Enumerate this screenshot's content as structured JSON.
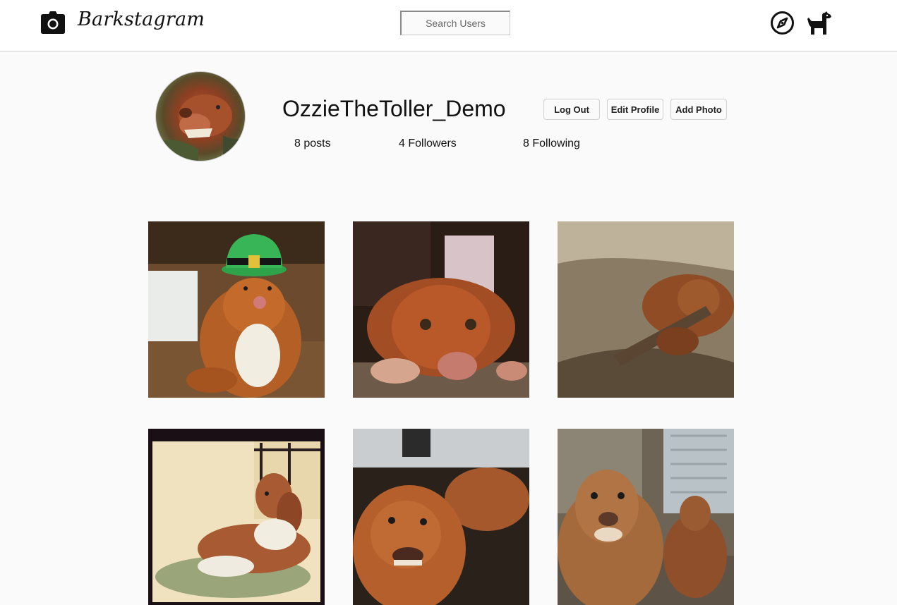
{
  "header": {
    "brand_title": "Barkstagram",
    "search": {
      "placeholder": "Search Users",
      "value": ""
    },
    "icons": [
      "camera-icon",
      "compass-icon",
      "dog-icon"
    ]
  },
  "profile": {
    "username": "OzzieTheToller_Demo",
    "buttons": {
      "logout": "Log Out",
      "edit_profile": "Edit Profile",
      "add_photo": "Add Photo"
    },
    "stats": {
      "posts": "8 posts",
      "followers": "4 Followers",
      "following": "8 Following"
    }
  },
  "colors": {
    "page_background": "#fafafa",
    "header_background": "#ffffff",
    "text": "#111111"
  }
}
